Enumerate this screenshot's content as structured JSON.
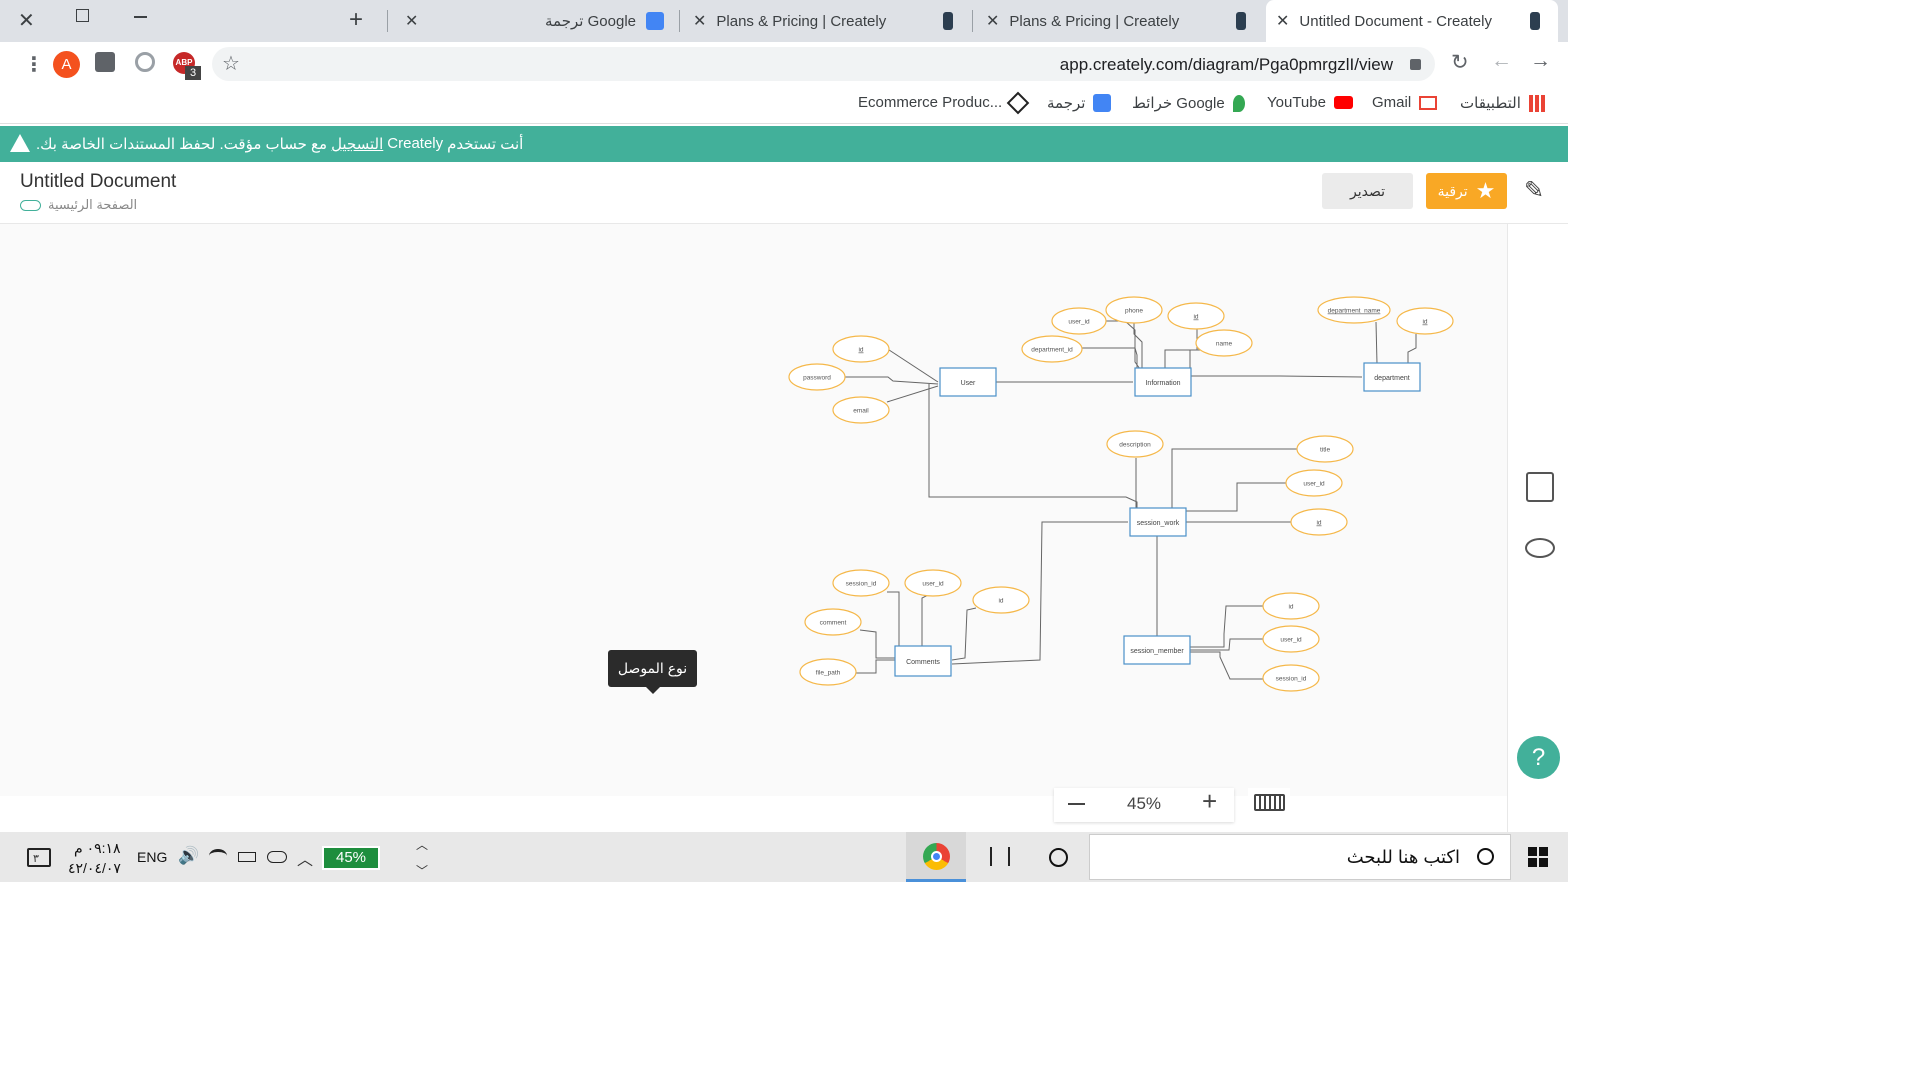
{
  "browser": {
    "tabs": [
      {
        "title": "Untitled Document - Creately",
        "active": true
      },
      {
        "title": "Plans & Pricing | Creately",
        "active": false
      },
      {
        "title": "Plans & Pricing | Creately",
        "active": false
      },
      {
        "title": "ترجمة Google",
        "active": false
      }
    ],
    "url": "app.creately.com/diagram/Pga0pmrgzlI/view",
    "profile_initial": "A",
    "abp_badge": "3",
    "bookmarks": [
      {
        "label": "التطبيقات",
        "icon": "apps-grid-icon"
      },
      {
        "label": "Gmail",
        "icon": "gmail-icon"
      },
      {
        "label": "YouTube",
        "icon": "youtube-icon"
      },
      {
        "label": "خرائط Google",
        "icon": "maps-icon"
      },
      {
        "label": "ترجمة",
        "icon": "translate-icon"
      },
      {
        "label": "Ecommerce Produc...",
        "icon": "codepen-icon"
      }
    ]
  },
  "banner": {
    "part1": "أنت تستخدم",
    "brand": "Creately",
    "link": "التسجيل",
    "part2": "مع حساب مؤقت. لحفظ المستندات الخاصة بك."
  },
  "document": {
    "title": "Untitled Document",
    "breadcrumb": "الصفحة الرئيسية",
    "upgrade_label": "ترقية",
    "export_label": "تصدير"
  },
  "tooltip": "نوع الموصل",
  "zoom": {
    "level": "45%"
  },
  "colors": {
    "accent": "#42b09a",
    "upgrade": "#f9a825",
    "entity": "#4a90c8",
    "attribute": "#f5b84a"
  },
  "diagram": {
    "entities": [
      {
        "id": "user",
        "label": "User"
      },
      {
        "id": "information",
        "label": "Information"
      },
      {
        "id": "department",
        "label": "department"
      },
      {
        "id": "session_work",
        "label": "session_work"
      },
      {
        "id": "session_member",
        "label": "session_member"
      },
      {
        "id": "comments",
        "label": "Comments"
      }
    ],
    "attributes": [
      {
        "label": "id",
        "underline": true
      },
      {
        "label": "password",
        "underline": false
      },
      {
        "label": "email",
        "underline": false
      },
      {
        "label": "user_id",
        "underline": false
      },
      {
        "label": "phone",
        "underline": false
      },
      {
        "label": "id",
        "underline": true
      },
      {
        "label": "department_id",
        "underline": false
      },
      {
        "label": "name",
        "underline": false
      },
      {
        "label": "department_name",
        "underline": true
      },
      {
        "label": "id",
        "underline": true
      },
      {
        "label": "description",
        "underline": false
      },
      {
        "label": "title",
        "underline": false
      },
      {
        "label": "user_id",
        "underline": false
      },
      {
        "label": "id",
        "underline": true
      },
      {
        "label": "session_id",
        "underline": false
      },
      {
        "label": "user_id",
        "underline": false
      },
      {
        "label": "id",
        "underline": false
      },
      {
        "label": "comment",
        "underline": false
      },
      {
        "label": "file_path",
        "underline": false
      },
      {
        "label": "id",
        "underline": false
      },
      {
        "label": "user_id",
        "underline": false
      },
      {
        "label": "session_id",
        "underline": false
      }
    ]
  },
  "taskbar": {
    "search_placeholder": "اكتب هنا للبحث",
    "battery": "45%",
    "language": "ENG",
    "time": "٠٩:١٨ م",
    "date": "٤٢/٠٤/٠٧",
    "notifications": "٣"
  }
}
